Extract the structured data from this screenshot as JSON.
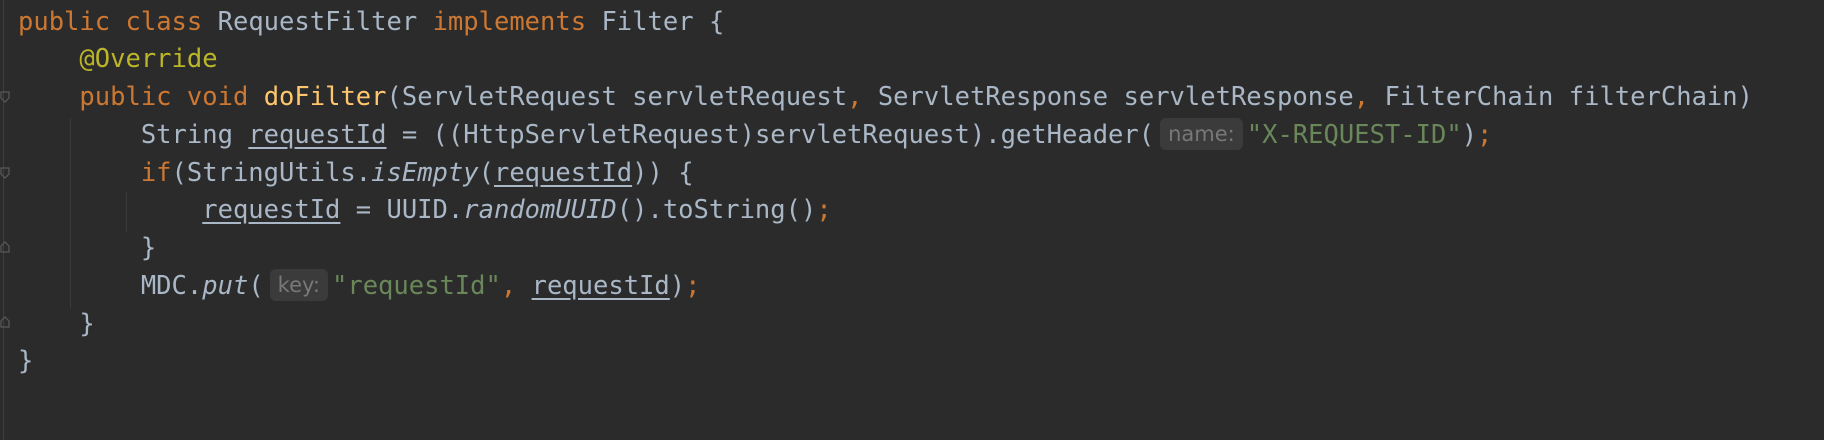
{
  "code": {
    "class_decl": {
      "kw_public": "public",
      "kw_class": "class",
      "class_name": "RequestFilter",
      "kw_implements": "implements",
      "interface_name": "Filter",
      "open_brace": "{"
    },
    "override": "@Override",
    "method_sig": {
      "kw_public": "public",
      "kw_void": "void",
      "method_name": "doFilter",
      "open_paren": "(",
      "p1_type": "ServletRequest",
      "p1_name": "servletRequest",
      "comma1": ",",
      "p2_type": "ServletResponse",
      "p2_name": "servletResponse",
      "comma2": ",",
      "p3_type": "FilterChain",
      "p3_name": "filterChain",
      "close": ")"
    },
    "line_request_id": {
      "type": "String",
      "var": "requestId",
      "expr": "= ((HttpServletRequest)servletRequest).getHeader(",
      "hint": "name:",
      "arg": "\"X-REQUEST-ID\"",
      "close": ")",
      "semicolon": ";"
    },
    "if_line": {
      "kw_if": "if",
      "call": "(StringUtils.",
      "method": "isEmpty",
      "open": "(",
      "var": "requestId",
      "close": ")) {"
    },
    "assign_line": {
      "var": "requestId",
      "expr": "= UUID.",
      "method": "randomUUID",
      "rest": "().toString()",
      "semicolon": ";"
    },
    "if_close": "}",
    "mdc_line": {
      "obj": "MDC.",
      "method": "put",
      "open": "(",
      "hint": "key:",
      "arg": "\"requestId\"",
      "comma": ",",
      "var": "requestId",
      "close": ")",
      "semicolon": ";"
    },
    "method_close": "}",
    "class_close": "}"
  },
  "colors": {
    "background": "#2b2b2b",
    "keyword": "#cc7832",
    "annotation": "#bbb529",
    "method_decl": "#ffc66d",
    "string": "#6a8759",
    "default_text": "#a9b7c6",
    "hint_text": "#787878"
  }
}
